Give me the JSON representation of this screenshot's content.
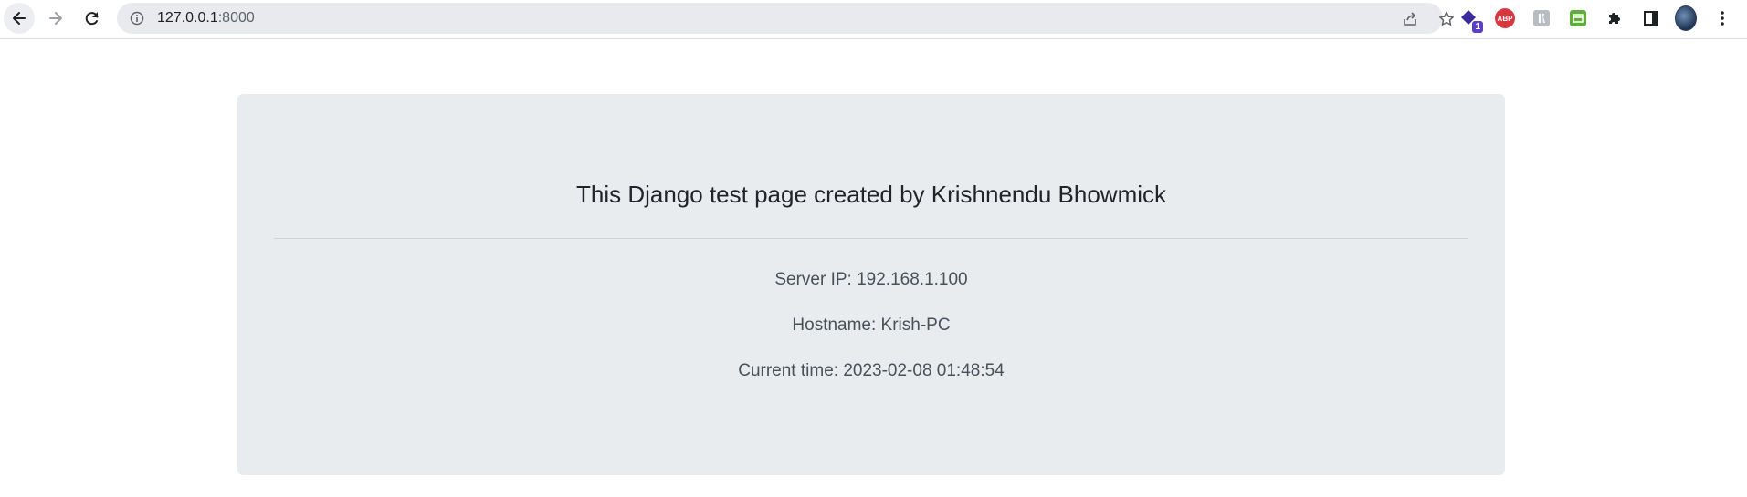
{
  "browser": {
    "url_host": "127.0.0.1",
    "url_port": ":8000",
    "extensions": [
      {
        "name": "extension-badge",
        "badge": "1"
      },
      {
        "name": "adblock-plus",
        "label": "ABP"
      }
    ]
  },
  "page": {
    "title": "This Django test page created by Krishnendu Bhowmick",
    "server_ip": "Server IP: 192.168.1.100",
    "hostname": "Hostname: Krish-PC",
    "current_time": "Current time: 2023-02-08 01:48:54"
  },
  "colors": {
    "jumbotron_bg": "#e9ecef",
    "title_text": "#212529",
    "info_text": "#495057"
  }
}
